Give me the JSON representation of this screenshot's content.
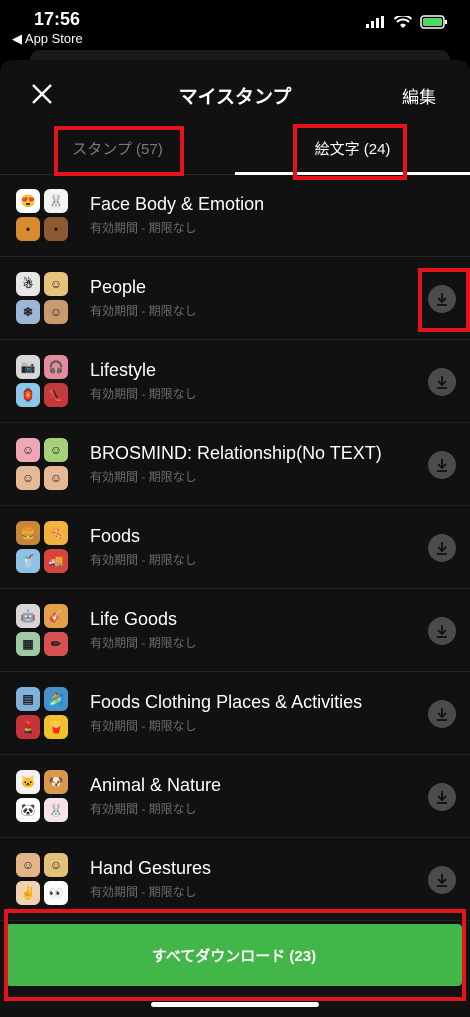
{
  "status": {
    "time": "17:56",
    "back_label": "◀ App Store",
    "battery_color": "#4cd964"
  },
  "nav": {
    "title": "マイスタンプ",
    "edit": "編集"
  },
  "tabs": [
    {
      "label": "スタンプ (57)",
      "selected": false
    },
    {
      "label": "絵文字 (24)",
      "selected": true
    }
  ],
  "items": [
    {
      "name": "Face Body & Emotion",
      "sub": "有効期間 - 期限なし"
    },
    {
      "name": "People",
      "sub": "有効期間 - 期限なし"
    },
    {
      "name": "Lifestyle",
      "sub": "有効期間 - 期限なし"
    },
    {
      "name": "BROSMIND: Relationship(No TEXT)",
      "sub": "有効期間 - 期限なし"
    },
    {
      "name": "Foods",
      "sub": "有効期間 - 期限なし"
    },
    {
      "name": "Life Goods",
      "sub": "有効期間 - 期限なし"
    },
    {
      "name": "Foods Clothing Places & Activities",
      "sub": "有効期間 - 期限なし"
    },
    {
      "name": "Animal & Nature",
      "sub": "有効期間 - 期限なし"
    },
    {
      "name": "Hand Gestures",
      "sub": "有効期間 - 期限なし"
    }
  ],
  "download_all": "すべてダウンロード (23)",
  "colors": {
    "accent_green": "#43b649",
    "highlight_red": "#e3141b"
  }
}
